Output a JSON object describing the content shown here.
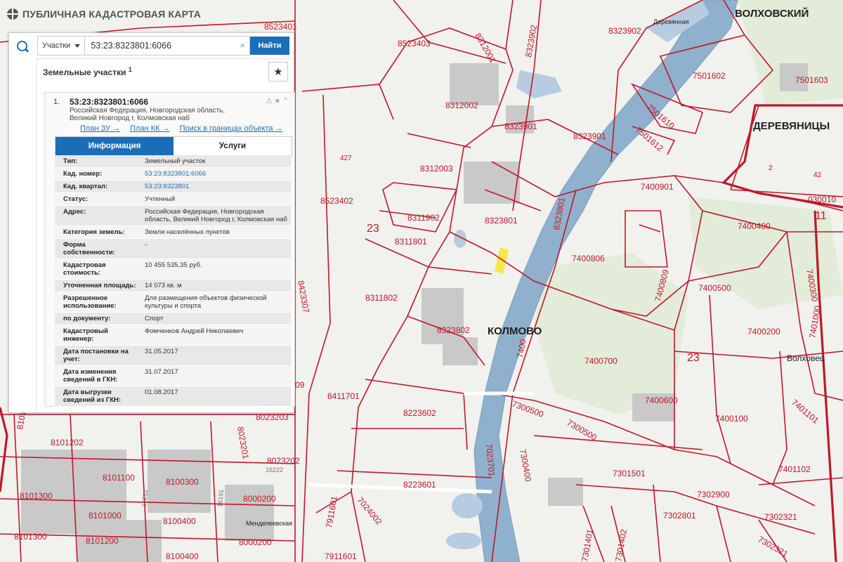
{
  "app": {
    "title": "ПУБЛИЧНАЯ КАДАСТРОВАЯ КАРТА",
    "icon": "globe-icon"
  },
  "search": {
    "scope": "Участки",
    "query": "53:23:8323801:6066",
    "button": "Найти",
    "clear": "×"
  },
  "results": {
    "title": "Земельные участки",
    "count": "1"
  },
  "card": {
    "index": "1.",
    "number": "53:23:8323801:6066",
    "address_line1": "Российская Федерация, Новгородская область,",
    "address_line2": "Великий Новгород г, Колмовская наб",
    "links": [
      "План ЗУ →",
      "План КК →",
      "Поиск в границах объекта →"
    ],
    "tabs": [
      "Информация",
      "Услуги"
    ],
    "fields": [
      {
        "k": "Тип:",
        "v": "Земельный участок"
      },
      {
        "k": "Кад. номер:",
        "v": "53:23:8323801:6066"
      },
      {
        "k": "Кад. квартал:",
        "v": "53:23:8323801"
      },
      {
        "k": "Статус:",
        "v": "Учтенный"
      },
      {
        "k": "Адрес:",
        "v": "Российская Федерация, Новгородская область, Великий Новгород г, Колмовская наб"
      },
      {
        "k": "Категория земель:",
        "v": "Земли населённых пунктов"
      },
      {
        "k": "Форма собственности:",
        "v": "-"
      },
      {
        "k": "Кадастровая стоимость:",
        "v": "10 455 535,35 руб."
      },
      {
        "k": "Уточненная площадь:",
        "v": "14 073 кв. м"
      },
      {
        "k": "Разрешенное использование:",
        "v": "Для размещения объектов физической культуры и спорта"
      },
      {
        "k": "по документу:",
        "v": "Спорт"
      },
      {
        "k": "Кадастровый инженер:",
        "v": "Фомченков Андрей Николаевич"
      },
      {
        "k": "Дата постановки на учет:",
        "v": "31.05.2017"
      },
      {
        "k": "Дата изменения сведений в ГКН:",
        "v": "31.07.2017"
      },
      {
        "k": "Дата выгрузки сведений из ГКН:",
        "v": "01.08.2017"
      }
    ]
  },
  "map_labels": {
    "q8523401": "8523401",
    "q8523403": "8523403",
    "q8312001": "8312001",
    "q8323902": "8323902",
    "q8312002": "8312002",
    "q8323901a": "8323901",
    "q8323901b": "8323901",
    "q8312003": "8312003",
    "q8523402": "8523402",
    "q8311902": "8311902",
    "q8311801": "8311801",
    "q8323801": "8323801",
    "q8311802": "8311802",
    "q8323802": "8323802",
    "q8423307": "8423307",
    "q8411701": "8411701",
    "q8223602": "8223602",
    "q8223601": "8223601",
    "q8023203": "8023203",
    "q8023202": "8023202",
    "q8023201": "8023201",
    "q8101201": "8101201",
    "q8101202": "8101202",
    "q8101300": "8101300",
    "q8101100": "8101100",
    "q8100300": "8100300",
    "q8000200": "8000200",
    "q8101000": "8101000",
    "q8100400": "8100400",
    "q8101300b": "8101300",
    "q8101200": "8101200",
    "q8000200b": "8000200",
    "q8100400b": "8100400",
    "q7911601": "7911601",
    "q7024002": "7024002",
    "q7911601b": "7911601",
    "q7023701": "7023701",
    "q7300400": "7300400",
    "q7300500": "7300500",
    "q7300500b": "7300500",
    "q7301401": "7301401",
    "q7301402": "7301402",
    "q7301501": "7301501",
    "q7302801": "7302801",
    "q7302900": "7302900",
    "q7302321": "7302321",
    "q7302321b": "7302321",
    "q7401102": "7401102",
    "q7401101": "7401101",
    "q7400100": "7400100",
    "q7400600": "7400600",
    "q7400700": "7400700",
    "q7400200": "7400200",
    "q7400500": "7400500",
    "q7400809": "7400809",
    "q7400806": "7400806",
    "q7400400": "7400400",
    "q7400901": "7400901",
    "q7501612": "7501612",
    "q7501610": "7501610",
    "q7501602": "7501602",
    "q7501603": "7501603",
    "q8323902b": "8323902",
    "q8323801b": "8323801",
    "q7400300": "7400300",
    "q7401000": "7401000",
    "q030010": "030010",
    "q7400": "7400",
    "n23a": "23",
    "n23b": "23",
    "n11": "11",
    "n42": "42",
    "n2": "2",
    "n427": "427",
    "n1": "1",
    "n0500": "0500",
    "n09": "09",
    "r16222": "16222",
    "r16212": "16212",
    "r16191": "16191",
    "place_kolmovo": "КОЛМОВО",
    "place_derevyanitsy": "ДЕРЕВЯНИЦЫ",
    "place_volkhovsky": "ВОЛХОВСКИЙ",
    "place_volkhovets": "Волховец",
    "street_mendeleevskaya": "Менделеевская",
    "map_derevyannaya": "Деревянная"
  },
  "colors": {
    "parcel_border": "#c0182a",
    "river": "#8fb1cd",
    "accent": "#1c6db8",
    "highlight": "#f7e64a"
  }
}
